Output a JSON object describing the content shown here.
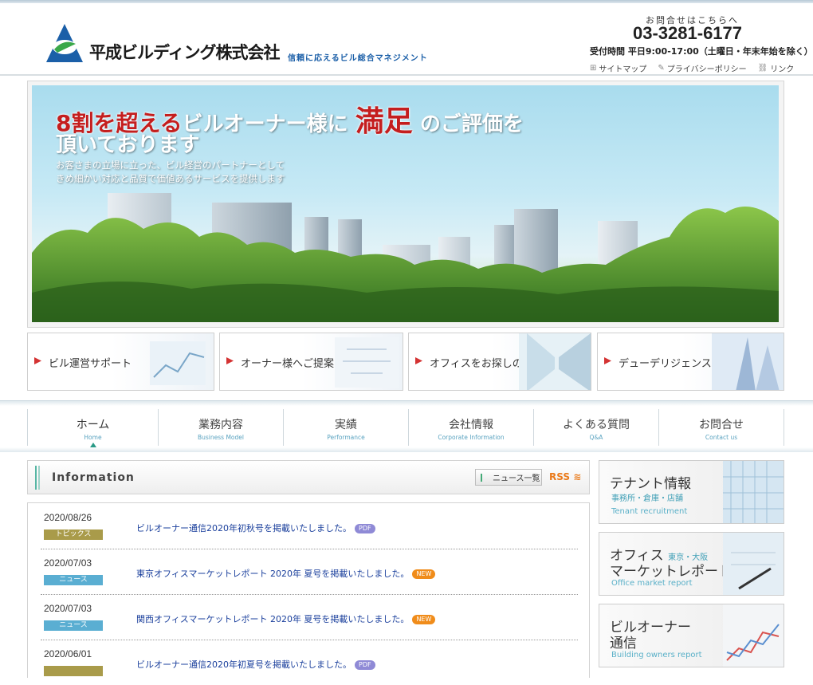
{
  "header": {
    "company_name": "平成ビルディング株式会社",
    "tagline": "信頼に応えるビル総合マネジメント",
    "contact_title": "お問合せはこちらへ",
    "phone": "03-3281-6177",
    "hours": "受付時間 平日9:00-17:00（土曜日・年末年始を除く）",
    "utility_links": [
      {
        "label": "サイトマップ",
        "icon": "sitemap-icon"
      },
      {
        "label": "プライバシーポリシー",
        "icon": "pen-icon"
      },
      {
        "label": "リンク",
        "icon": "link-icon"
      }
    ]
  },
  "hero": {
    "line1_highlight": "8割を超える",
    "line1_middle": "ビルオーナー様に",
    "line1_emphasis": "満足",
    "line1_end": "のご評価を",
    "line2": "頂いております",
    "sub_line1": "お客さまの立場に立った、ビル経営のパートナーとして",
    "sub_line2": "きめ細かい対応と品質で価値あるサービスを提供します"
  },
  "promos": [
    {
      "label": "ビル運営サポート"
    },
    {
      "label": "オーナー様へご提案"
    },
    {
      "label": "オフィスをお探しの方へ"
    },
    {
      "label": "デューデリジェンス"
    }
  ],
  "nav": [
    {
      "ja": "ホーム",
      "en": "Home",
      "active": true
    },
    {
      "ja": "業務内容",
      "en": "Business Model"
    },
    {
      "ja": "実績",
      "en": "Performance"
    },
    {
      "ja": "会社情報",
      "en": "Corporate Information"
    },
    {
      "ja": "よくある質問",
      "en": "Q&A"
    },
    {
      "ja": "お問合せ",
      "en": "Contact us"
    }
  ],
  "info": {
    "title": "Information",
    "news_list_label": "ニュース一覧",
    "rss_label": "RSS",
    "items": [
      {
        "date": "2020/08/26",
        "tag": "トピックス",
        "title": "ビルオーナー通信2020年初秋号を掲載いたしました。",
        "badge": "PDF"
      },
      {
        "date": "2020/07/03",
        "tag": "ニュース",
        "title": "東京オフィスマーケットレポート 2020年 夏号を掲載いたしました。",
        "badge": "NEW"
      },
      {
        "date": "2020/07/03",
        "tag": "ニュース",
        "title": "関西オフィスマーケットレポート 2020年 夏号を掲載いたしました。",
        "badge": "NEW"
      },
      {
        "date": "2020/06/01",
        "tag": "",
        "title": "ビルオーナー通信2020年初夏号を掲載いたしました。",
        "badge": "PDF"
      }
    ]
  },
  "sidebar": [
    {
      "title": "テナント情報",
      "sub": "事務所・倉庫・店舗",
      "en": "Tenant recruitment"
    },
    {
      "title": "オフィス",
      "title_note": "東京・大阪",
      "title2": "マーケットレポート",
      "en": "Office market report"
    },
    {
      "title": "ビルオーナー",
      "title2": "通信",
      "en": "Building owners report"
    }
  ],
  "colors": {
    "brand_blue": "#1b5fa8",
    "brand_green": "#3aa84a",
    "accent_red": "#c41e1e",
    "teal": "#2a9a86",
    "topics_tag": "#a99b4a",
    "news_tag": "#5aaed2"
  }
}
